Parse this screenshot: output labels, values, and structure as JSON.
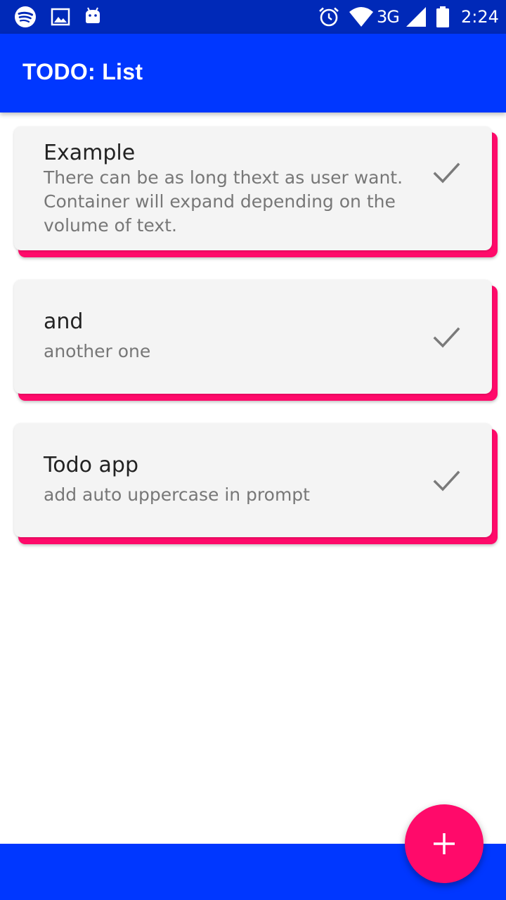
{
  "status_bar": {
    "time": "2:24",
    "network": "3G",
    "left_icons": [
      "spotify-icon",
      "image-icon",
      "android-icon"
    ],
    "right_icons": [
      "alarm-icon",
      "wifi-icon",
      "signal-icon",
      "battery-icon"
    ]
  },
  "app_bar": {
    "title": "TODO: List",
    "color": "#0037ff"
  },
  "todos": [
    {
      "title": "Example",
      "description": "There can be as long thext as user want. Container will expand depending on the volume of text."
    },
    {
      "title": "and",
      "description": "another one"
    },
    {
      "title": "Todo app",
      "description": "add auto uppercase in prompt"
    }
  ],
  "fab": {
    "icon": "plus-icon",
    "color": "#ff0a6a"
  },
  "colors": {
    "status_bar": "#0029b8",
    "primary": "#0037ff",
    "accent": "#ff0a6a",
    "card": "#f4f4f4"
  }
}
